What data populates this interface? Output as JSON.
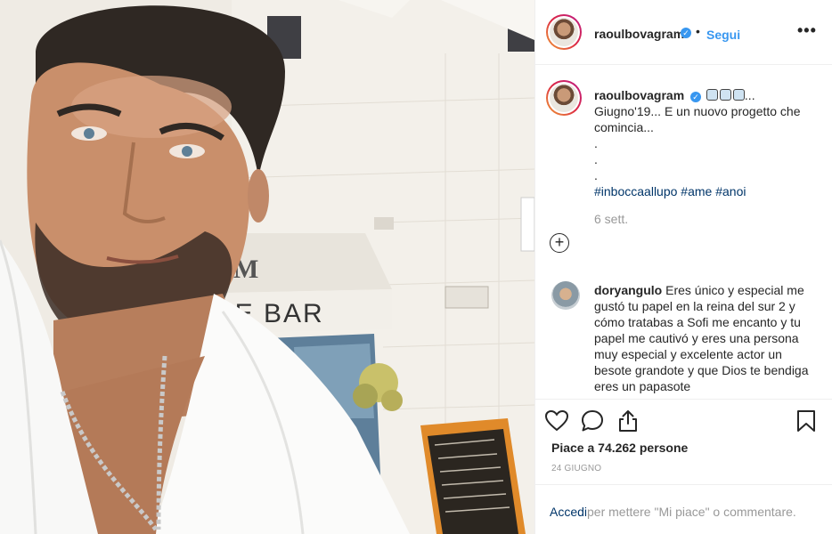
{
  "post": {
    "username": "raoulbovagram",
    "follow_label": "Segui",
    "separator": "•",
    "more_label": "•••",
    "caption_line1": "Giugno'19... E un nuovo progetto che comincia...",
    "caption_dots": [
      ".",
      ".",
      "."
    ],
    "caption_ellipsis": "...",
    "hashtags": [
      "#inboccaallupo",
      "#ame",
      "#anoi"
    ],
    "age": "6 sett.",
    "load_more_label": "+",
    "comment": {
      "username": "doryangulo",
      "text": "Eres único y especial me gustó tu papel en la reina del sur 2 y cómo tratabas a Sofi me encanto y tu papel me cautivó y eres una persona muy especial y excelente actor un besote grandote y que Dios te bendiga eres un papasote"
    },
    "likes_label": "Piace a 74.262 persone",
    "date": "24 GIUGNO",
    "login_link": "Accedi",
    "login_rest": "per mettere \"Mi piace\" o commentare."
  },
  "photo": {
    "sign_text": "NE BAR",
    "sign_logo": "M"
  },
  "colors": {
    "accent": "#3897f0",
    "hashtag": "#003569",
    "muted": "#999999"
  },
  "icons": {
    "like": "heart-icon",
    "comment": "comment-bubble-icon",
    "share": "share-icon",
    "save": "bookmark-icon",
    "verified": "verified-badge-icon",
    "more": "more-options-icon"
  }
}
